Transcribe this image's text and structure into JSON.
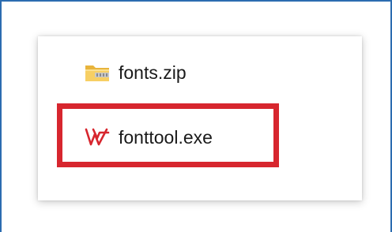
{
  "files": [
    {
      "name": "fonts.zip",
      "icon": "zip-folder-icon"
    },
    {
      "name": "fonttool.exe",
      "icon": "wps-office-icon"
    }
  ],
  "highlight_color": "#d7262e",
  "frame_color": "#2b6cb0"
}
